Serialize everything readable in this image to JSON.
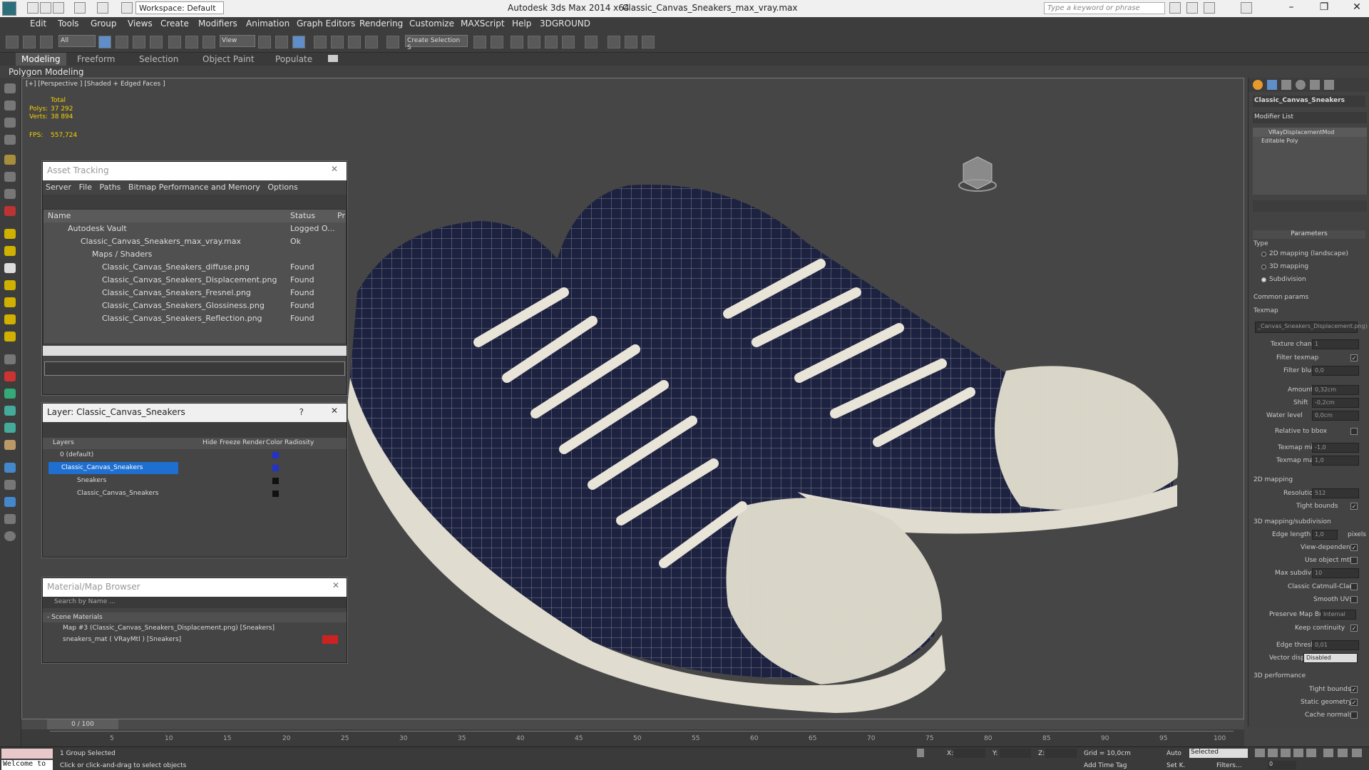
{
  "titlebar": {
    "workspace": "Workspace: Default",
    "app": "Autodesk 3ds Max  2014 x64",
    "file": "Classic_Canvas_Sneakers_max_vray.max",
    "search_placeholder": "Type a keyword or phrase"
  },
  "menu": [
    "Edit",
    "Tools",
    "Group",
    "Views",
    "Create",
    "Modifiers",
    "Animation",
    "Graph Editors",
    "Rendering",
    "Customize",
    "MAXScript",
    "Help",
    "3DGROUND"
  ],
  "toolbar": {
    "filter": "All",
    "view": "View",
    "selection_set": "Create Selection S"
  },
  "ribbon": {
    "tabs": [
      "Modeling",
      "Freeform",
      "Selection",
      "Object Paint",
      "Populate"
    ],
    "sub": "Polygon Modeling"
  },
  "viewport": {
    "label": "[+] [Perspective ] [Shaded + Edged Faces ]",
    "stats": {
      "total": "Total",
      "polys_label": "Polys:",
      "polys": "37 292",
      "verts_label": "Verts:",
      "verts": "38 894",
      "fps_label": "FPS:",
      "fps": "557,724"
    }
  },
  "asset_tracking": {
    "title": "Asset Tracking",
    "menu": [
      "Server",
      "File",
      "Paths",
      "Bitmap Performance and Memory",
      "Options"
    ],
    "cols": [
      "Name",
      "Status",
      "Pr"
    ],
    "rows": [
      {
        "name": "Autodesk Vault",
        "status": "Logged O..."
      },
      {
        "name": "Classic_Canvas_Sneakers_max_vray.max",
        "status": "Ok"
      },
      {
        "name": "Maps / Shaders",
        "status": ""
      },
      {
        "name": "Classic_Canvas_Sneakers_diffuse.png",
        "status": "Found"
      },
      {
        "name": "Classic_Canvas_Sneakers_Displacement.png",
        "status": "Found"
      },
      {
        "name": "Classic_Canvas_Sneakers_Fresnel.png",
        "status": "Found"
      },
      {
        "name": "Classic_Canvas_Sneakers_Glossiness.png",
        "status": "Found"
      },
      {
        "name": "Classic_Canvas_Sneakers_Reflection.png",
        "status": "Found"
      }
    ]
  },
  "layer": {
    "title": "Layer: Classic_Canvas_Sneakers",
    "help": "?",
    "cols": [
      "Layers",
      "Hide",
      "Freeze",
      "Render",
      "Color",
      "Radiosity"
    ],
    "rows": [
      {
        "name": "0 (default)",
        "color": "#2233cc"
      },
      {
        "name": "Classic_Canvas_Sneakers",
        "color": "#2233cc"
      },
      {
        "name": "Sneakers",
        "color": "#111111"
      },
      {
        "name": "Classic_Canvas_Sneakers",
        "color": "#111111"
      }
    ]
  },
  "material_browser": {
    "title": "Material/Map Browser",
    "search": "Search by Name ...",
    "group": "- Scene Materials",
    "items": [
      "Map #3 (Classic_Canvas_Sneakers_Displacement.png) [Sneakers]",
      "sneakers_mat  ( VRayMtl ) [Sneakers]"
    ]
  },
  "command_panel": {
    "object_name": "Classic_Canvas_Sneakers",
    "modifier_list": "Modifier List",
    "stack": [
      "VRayDisplacementMod",
      "Editable Poly"
    ],
    "rollout": "Parameters",
    "type_label": "Type",
    "types": [
      "2D mapping (landscape)",
      "3D mapping",
      "Subdivision"
    ],
    "common": "Common params",
    "texmap_label": "Texmap",
    "texmap": "_Canvas_Sneakers_Displacement.png)",
    "props": [
      {
        "label": "Texture chan",
        "value": "1"
      },
      {
        "label": "Filter texmap",
        "value": ""
      },
      {
        "label": "Filter blur",
        "value": "0,0"
      },
      {
        "label": "Amount",
        "value": "0,32cm"
      },
      {
        "label": "Shift",
        "value": "-0,2cm"
      },
      {
        "label": "Water level",
        "value": "0,0cm"
      },
      {
        "label": "Relative to bbox",
        "value": ""
      },
      {
        "label": "Texmap min",
        "value": "-1,0"
      },
      {
        "label": "Texmap max",
        "value": "1,0"
      }
    ],
    "sec2d": "2D mapping",
    "resolution_label": "Resolution",
    "resolution": "512",
    "tight_bounds": "Tight bounds",
    "sec3d": "3D mapping/subdivision",
    "edge_length_label": "Edge length",
    "edge_length": "1,0",
    "pixels": "pixels",
    "view_dependent": "View-dependent",
    "use_object_mtl": "Use object mtl",
    "max_subdivs_label": "Max subdivs",
    "max_subdivs": "10",
    "catmull": "Classic Catmull-Clark",
    "smooth_uvs": "Smooth UVs",
    "preserve_label": "Preserve Map Bnd",
    "preserve": "Internal",
    "keep_continuity": "Keep continuity",
    "edge_thresh_label": "Edge thresh",
    "edge_thresh": "0,01",
    "vector_label": "Vector displ",
    "vector": "Disabled",
    "perf": "3D performance",
    "tight_bounds2": "Tight bounds",
    "static_geometry": "Static geometry",
    "cache_normals": "Cache normals"
  },
  "timeline": {
    "frame": "0 / 100",
    "ticks": [
      "5",
      "10",
      "15",
      "20",
      "25",
      "30",
      "35",
      "40",
      "45",
      "50",
      "55",
      "60",
      "65",
      "70",
      "75",
      "80",
      "85",
      "90",
      "95",
      "100"
    ]
  },
  "status": {
    "welcome": "Welcome to",
    "selected": "1 Group Selected",
    "hint": "Click or click-and-drag to select objects",
    "x": "X:",
    "y": "Y:",
    "z": "Z:",
    "grid": "Grid = 10,0cm",
    "add_time_tag": "Add Time Tag",
    "auto": "Auto",
    "set_k": "Set K.",
    "mode": "Selected",
    "filters": "Filters...",
    "frame_field": "0"
  }
}
